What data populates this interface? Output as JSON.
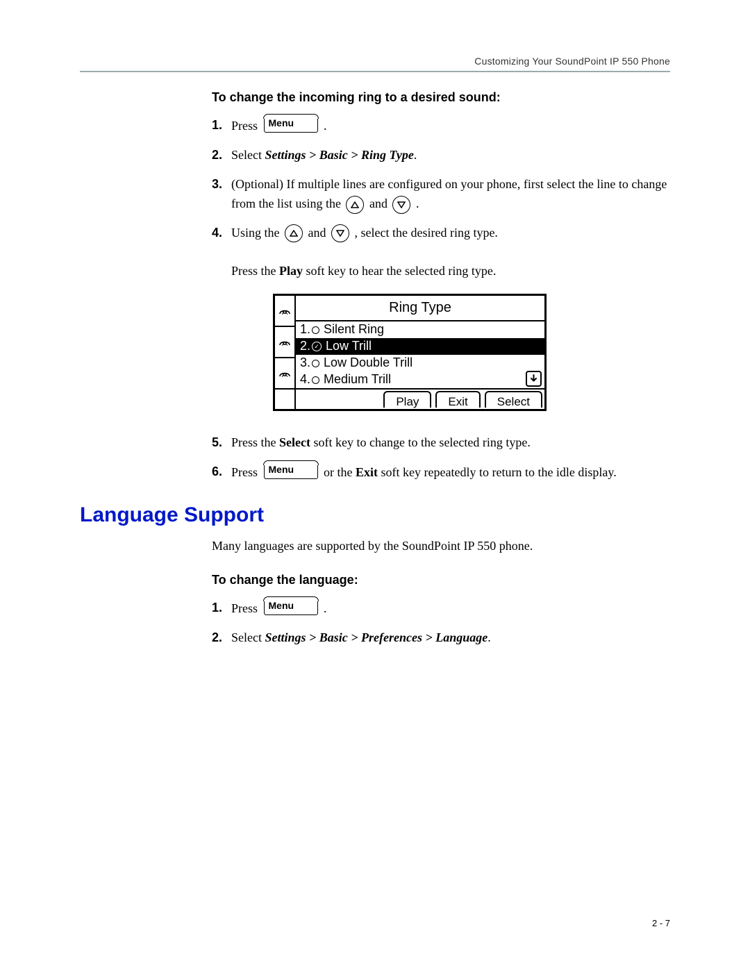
{
  "header": {
    "running_head": "Customizing Your SoundPoint IP 550 Phone"
  },
  "section1": {
    "title": "To change the incoming ring to a desired sound:",
    "steps": {
      "s1": {
        "num": "1.",
        "a": "Press ",
        "menu": "Menu",
        "b": " ."
      },
      "s2": {
        "num": "2.",
        "a": "Select ",
        "path": "Settings > Basic > Ring Type",
        "b": "."
      },
      "s3": {
        "num": "3.",
        "a": "(Optional) If multiple lines are configured on your phone, first select the line to change from the list using the ",
        "b": " and ",
        "c": " ."
      },
      "s4": {
        "num": "4.",
        "a": "Using the ",
        "b": " and ",
        "c": " , select the desired ring type.",
        "d": "Press the ",
        "play": "Play",
        "e": " soft key to hear the selected ring type."
      },
      "s5": {
        "num": "5.",
        "a": "Press the ",
        "select": "Select",
        "b": " soft key to change to the selected ring type."
      },
      "s6": {
        "num": "6.",
        "a": "Press ",
        "menu": "Menu",
        "b": " or the ",
        "exit": "Exit",
        "c": " soft key repeatedly to return to the idle display."
      }
    }
  },
  "lcd": {
    "title": "Ring Type",
    "rows": [
      {
        "idx": "1.",
        "label": "Silent Ring",
        "selected": false
      },
      {
        "idx": "2.",
        "label": "Low Trill",
        "selected": true
      },
      {
        "idx": "3.",
        "label": "Low Double Trill",
        "selected": false
      },
      {
        "idx": "4.",
        "label": "Medium Trill",
        "selected": false
      }
    ],
    "softkeys": {
      "play": "Play",
      "exit": "Exit",
      "select": "Select"
    }
  },
  "section2": {
    "heading": "Language Support",
    "intro": "Many languages are supported by the SoundPoint IP 550 phone.",
    "title": "To change the language:",
    "steps": {
      "s1": {
        "num": "1.",
        "a": "Press ",
        "menu": "Menu",
        "b": " ."
      },
      "s2": {
        "num": "2.",
        "a": "Select ",
        "path": "Settings > Basic > Preferences > Language",
        "b": "."
      }
    }
  },
  "footer": {
    "page": "2 - 7"
  }
}
